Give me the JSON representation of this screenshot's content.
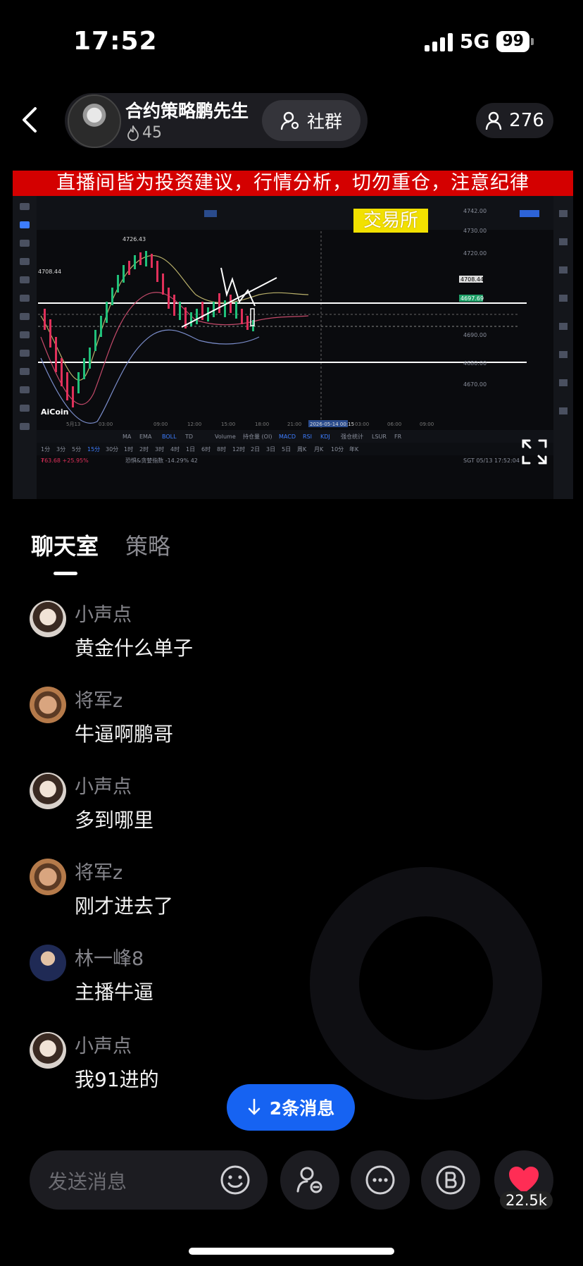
{
  "status_bar": {
    "time": "17:52",
    "network": "5G",
    "battery": "99"
  },
  "header": {
    "host_name": "合约策略鹏先生",
    "heat": "45",
    "group_label": "社群",
    "viewers": "276"
  },
  "video": {
    "banner": "直播间皆为投资建议，行情分析，切勿重仓，注意纪律",
    "exchange_label": "交易所",
    "price_labels": [
      "4742.00",
      "4730.00",
      "4720.00",
      "4708.44",
      "4697.69",
      "4690.00",
      "4680.00",
      "4670.00"
    ],
    "peak_label": "4726.43",
    "left_label": "4708.44",
    "time_labels": [
      "5月13",
      "03:00",
      "09:00",
      "12:00",
      "15:00",
      "18:00",
      "21:00",
      "2026-05-14 00:15",
      "03:00",
      "06:00",
      "09:00"
    ],
    "watermark": "AiCoin",
    "indicators": [
      "MA",
      "EMA",
      "BOLL",
      "TD",
      "Volume",
      "持仓量 (OI)",
      "MACD",
      "RSI",
      "KDJ",
      "强仓统计",
      "LSUR",
      "FR"
    ],
    "periods": [
      "1分",
      "3分",
      "5分",
      "15分",
      "30分",
      "1时",
      "2时",
      "3时",
      "4时",
      "1日",
      "6时",
      "8时",
      "12时",
      "2日",
      "3日",
      "5日",
      "周K",
      "月K",
      "10分",
      "年K"
    ],
    "footer_left": "₮63.68  +25.95%",
    "footer_mid": "恐惧&贪婪指数  -14.29%  42",
    "footer_right": "SGT 05/13 17:52:04"
  },
  "tabs": {
    "chat": "聊天室",
    "strategy": "策略"
  },
  "messages": [
    {
      "name": "小声点",
      "text": "黄金什么单子",
      "avatar": "girl"
    },
    {
      "name": "将军z",
      "text": "牛逼啊鹏哥",
      "avatar": "man"
    },
    {
      "name": "小声点",
      "text": "多到哪里",
      "avatar": "girl"
    },
    {
      "name": "将军z",
      "text": "刚才进去了",
      "avatar": "man"
    },
    {
      "name": "林一峰8",
      "text": "主播牛逼",
      "avatar": "suit"
    },
    {
      "name": "小声点",
      "text": "我91进的",
      "avatar": "girl"
    }
  ],
  "new_messages": "2条消息",
  "composer": {
    "placeholder": "发送消息"
  },
  "likes": "22.5k",
  "colors": {
    "accent_blue": "#1663f2",
    "like_red": "#ff2d55",
    "banner_red": "#d40000",
    "exchange_yellow": "#f2e100"
  }
}
